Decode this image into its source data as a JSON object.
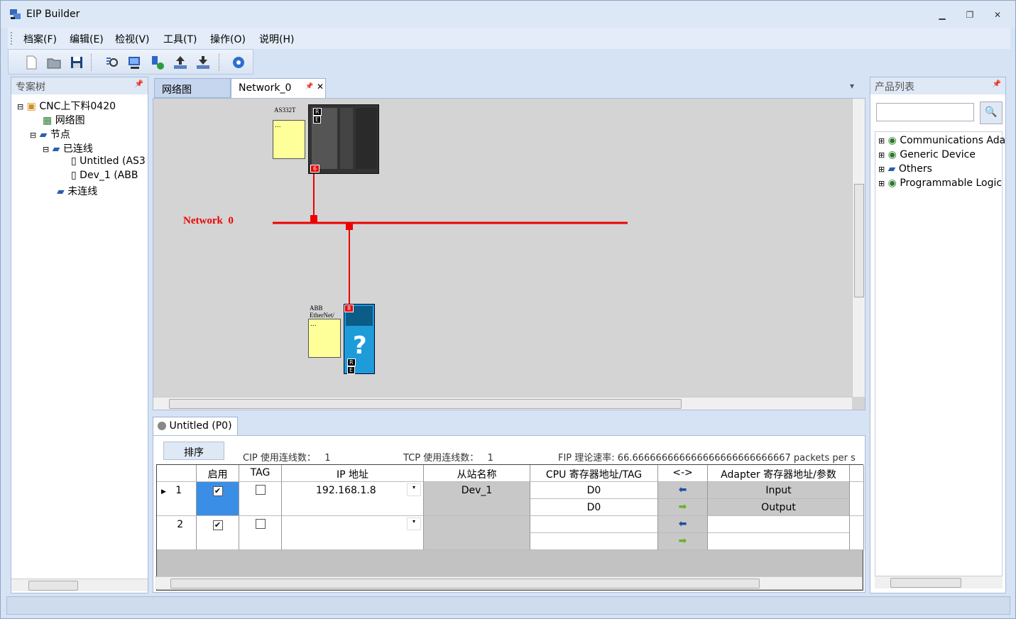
{
  "window": {
    "title": "EIP Builder",
    "min": "▁",
    "restore": "❐",
    "close": "✕"
  },
  "menu": [
    "档案(F)",
    "编辑(E)",
    "检视(V)",
    "工具(T)",
    "操作(O)",
    "说明(H)"
  ],
  "toolbar": [
    "new-file-icon",
    "open-folder-icon",
    "save-icon",
    "scan-network-icon",
    "monitor-icon",
    "download-device-icon",
    "upload-icon",
    "download-icon",
    "settings-gear-icon"
  ],
  "project_tree": {
    "title": "专案树",
    "pin": "📌",
    "root": "CNC上下料0420",
    "network": "网络图",
    "nodes": "节点",
    "connected": "已连线",
    "dev_untitled": "Untitled (AS3",
    "dev_1": "Dev_1 (ABB",
    "disconnected": "未连线"
  },
  "tabs": {
    "tab1": "网络图",
    "tab2": "Network_0",
    "tab2_pin": "📌",
    "tab2_close": "✕",
    "dropdown": "▾"
  },
  "diagram": {
    "device1_label": "AS332T",
    "device1_note": "...",
    "device1_port": "6",
    "device1_r": "R",
    "device1_e": "E",
    "network_label": "Network  0",
    "device2_label_line1": "ABB",
    "device2_label_line2": "EtherNet/",
    "device2_note": "...",
    "device2_port": "8",
    "device2_q": "?",
    "device2_r": "R",
    "device2_e": "E"
  },
  "bottom": {
    "tab": "Untitled (P0)",
    "sort_btn": "排序",
    "cip_label": "CIP 使用连线数：",
    "cip_value": "1",
    "tcp_label": "TCP 使用连线数：",
    "tcp_value": "1",
    "eip_text": "FIP 理论速率: 66.666666666666666666666666667 packets per s"
  },
  "grid": {
    "headers": [
      "启用",
      "TAG",
      "IP 地址",
      "从站名称",
      "CPU 寄存器地址/TAG",
      "<->",
      "Adapter 寄存器地址/参数"
    ],
    "rows": [
      {
        "num": "1",
        "enable": true,
        "tag": false,
        "ip": "192.168.1.8",
        "slave": "Dev_1",
        "cpu1": "D0",
        "cpu2": "D0",
        "adapter1": "Input",
        "adapter2": "Output"
      },
      {
        "num": "2",
        "enable": true,
        "tag": false,
        "ip": "",
        "slave": "",
        "cpu1": "",
        "cpu2": "",
        "adapter1": "",
        "adapter2": ""
      }
    ]
  },
  "products": {
    "title": "产品列表",
    "pin": "📌",
    "search_placeholder": "",
    "items": [
      "Communications Ada",
      "Generic Device",
      "Others",
      "Programmable Logic"
    ]
  },
  "colors": {
    "network": "#ee0000",
    "note": "#ffff99",
    "canvas": "#d4d4d4",
    "accent": "#3a8ee6"
  }
}
